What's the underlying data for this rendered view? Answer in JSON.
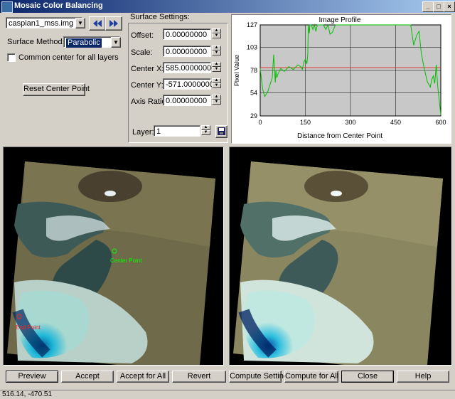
{
  "window": {
    "title": "Mosaic Color Balancing",
    "controls": [
      "_",
      "□",
      "×"
    ]
  },
  "left_controls": {
    "image_select": "caspian1_mss.img",
    "surface_method_label": "Surface Method:",
    "surface_method_value": "Parabolic",
    "common_center_label": "Common center for all layers",
    "common_center_checked": false,
    "reset_button": "Reset Center Point"
  },
  "surface_settings": {
    "title": "Surface Settings:",
    "fields": [
      {
        "label": "Offset:",
        "value": "0.00000000"
      },
      {
        "label": "Scale:",
        "value": "0.00000000"
      },
      {
        "label": "Center X:",
        "value": "585.00000000"
      },
      {
        "label": "Center Y:",
        "value": "-571.00000000"
      },
      {
        "label": "Axis Ratio:",
        "value": "0.00000000"
      }
    ],
    "layer_label": "Layer:",
    "layer_value": "1"
  },
  "chart_data": {
    "type": "line",
    "title": "Image Profile",
    "xlabel": "Distance from Center Point",
    "ylabel": "Pixel Value",
    "xlim": [
      0,
      600
    ],
    "ylim": [
      29,
      127
    ],
    "x_ticks": [
      "0",
      "150",
      "300",
      "450",
      "600"
    ],
    "y_ticks": [
      "127",
      "103",
      "78",
      "54",
      "29"
    ],
    "grid": true,
    "colors": {
      "profile": "#00c000",
      "reference": "#e03030",
      "background": "#c8c8c8"
    },
    "reference_line": 81,
    "series": [
      {
        "x": [
          0,
          8,
          15,
          25,
          40,
          45,
          50,
          52,
          55,
          60,
          68,
          80,
          95,
          110,
          125,
          135,
          140,
          145,
          150,
          155,
          158,
          160,
          163,
          165,
          170,
          175,
          180,
          185,
          190,
          200,
          210,
          218,
          225,
          232,
          240,
          250,
          260,
          280,
          300,
          320,
          340,
          360,
          380,
          400,
          420,
          440,
          460,
          480,
          500,
          510,
          520,
          528,
          535,
          545,
          555,
          565,
          570,
          575,
          580,
          585,
          590,
          595,
          600
        ],
        "values": [
          80,
          58,
          50,
          55,
          70,
          95,
          65,
          78,
          70,
          75,
          80,
          77,
          82,
          79,
          84,
          82,
          79,
          87,
          90,
          85,
          95,
          127,
          118,
          127,
          127,
          122,
          127,
          120,
          127,
          127,
          127,
          122,
          127,
          117,
          119,
          127,
          127,
          127,
          127,
          127,
          127,
          127,
          127,
          127,
          127,
          127,
          127,
          127,
          127,
          105,
          116,
          120,
          97,
          80,
          66,
          60,
          68,
          72,
          64,
          84,
          60,
          45,
          30
        ]
      }
    ]
  },
  "buttons": [
    "Preview",
    "Accept",
    "Accept for All",
    "Revert",
    "Compute Settings",
    "Compute for All",
    "Close",
    "Help"
  ],
  "status": {
    "coords": "516.14, -470.51"
  },
  "annotations": {
    "center_label": "Center Point",
    "end_label": "End Point"
  }
}
